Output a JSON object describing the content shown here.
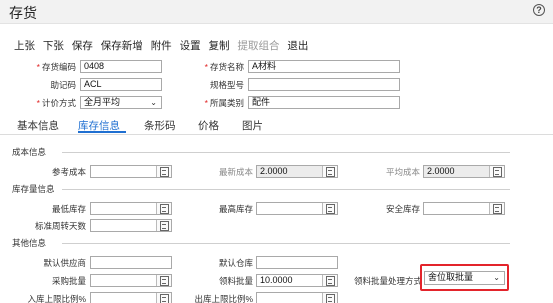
{
  "window": {
    "title": "存货",
    "help": "?"
  },
  "toolbar": {
    "items": [
      {
        "label": "上张",
        "enabled": true
      },
      {
        "label": "下张",
        "enabled": true
      },
      {
        "label": "保存",
        "enabled": true
      },
      {
        "label": "保存新增",
        "enabled": true
      },
      {
        "label": "附件",
        "enabled": true
      },
      {
        "label": "设置",
        "enabled": true
      },
      {
        "label": "复制",
        "enabled": true
      },
      {
        "label": "提取组合",
        "enabled": false
      },
      {
        "label": "退出",
        "enabled": true
      }
    ]
  },
  "header_form": {
    "code_label": "存货编码",
    "code_value": "0408",
    "name_label": "存货名称",
    "name_value": "A材料",
    "mnemonic_label": "助记码",
    "mnemonic_value": "ACL",
    "spec_label": "规格型号",
    "spec_value": "",
    "pricing_label": "计价方式",
    "pricing_value": "全月平均",
    "category_label": "所属类别",
    "category_value": "配件"
  },
  "tabs": [
    "基本信息",
    "库存信息",
    "条形码",
    "价格",
    "图片"
  ],
  "active_tab": "库存信息",
  "cost": {
    "title": "成本信息",
    "ref_cost_label": "参考成本",
    "ref_cost_value": "",
    "latest_cost_label": "最新成本",
    "latest_cost_value": "2.0000",
    "avg_cost_label": "平均成本",
    "avg_cost_value": "2.0000"
  },
  "stock": {
    "title": "库存量信息",
    "min_label": "最低库存",
    "min_value": "",
    "max_label": "最高库存",
    "max_value": "",
    "safe_label": "安全库存",
    "safe_value": "",
    "turnover_label": "标准周转天数",
    "turnover_value": ""
  },
  "other": {
    "title": "其他信息",
    "supplier_label": "默认供应商",
    "supplier_value": "",
    "warehouse_label": "默认仓库",
    "warehouse_value": "",
    "purchase_batch_label": "采购批量",
    "purchase_batch_value": "",
    "pick_batch_label": "领料批量",
    "pick_batch_value": "10.0000",
    "pick_method_label": "领料批量处理方式",
    "pick_method_value": "舍位取批量",
    "in_limit_label": "入库上限比例%",
    "out_limit_label": "出库上限比例%"
  },
  "icons": {
    "calculator": "calculator-icon",
    "dropdown": "chevron-down-icon"
  },
  "colors": {
    "accent": "#1f6fd1",
    "required": "#e02020",
    "highlight": "#e3242b"
  }
}
